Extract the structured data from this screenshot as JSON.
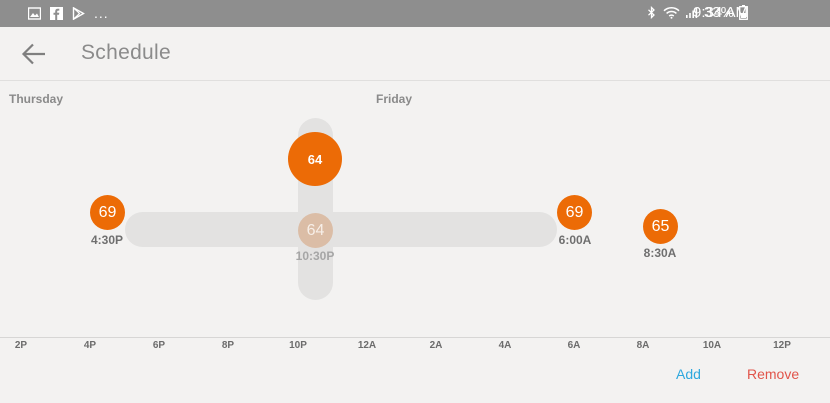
{
  "status_bar": {
    "left_icons": [
      "image-icon",
      "facebook-icon",
      "play-store-icon"
    ],
    "more": "...",
    "battery": "33%",
    "time": "9:34 AM"
  },
  "header": {
    "title": "Schedule"
  },
  "days": [
    "Thursday",
    "Friday"
  ],
  "setpoints": [
    {
      "value": "69",
      "time": "4:30P"
    },
    {
      "value": "64",
      "time": "10:30P"
    },
    {
      "value": "69",
      "time": "6:00A"
    },
    {
      "value": "65",
      "time": "8:30A"
    }
  ],
  "drag_value": "64",
  "axis_ticks": [
    "2P",
    "4P",
    "6P",
    "8P",
    "10P",
    "12A",
    "2A",
    "4A",
    "6A",
    "8A",
    "10A",
    "12P"
  ],
  "actions": {
    "add": "Add",
    "remove": "Remove"
  },
  "colors": {
    "accent": "#ec6b06",
    "add": "#2ea8de",
    "remove": "#e1544a"
  }
}
